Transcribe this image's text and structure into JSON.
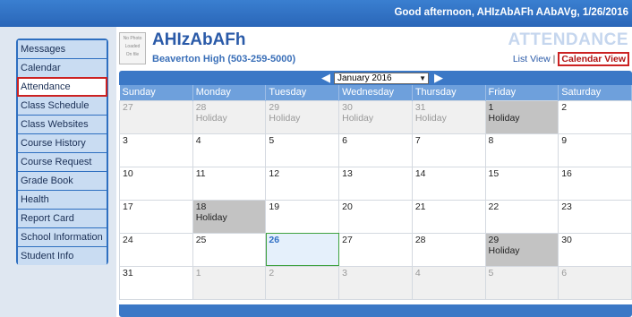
{
  "header": {
    "greeting": "Good afternoon, AHIzAbAFh AAbAVg, 1/26/2016"
  },
  "sidebar": {
    "items": [
      {
        "label": "Messages"
      },
      {
        "label": "Calendar"
      },
      {
        "label": "Attendance",
        "active": true
      },
      {
        "label": "Class Schedule"
      },
      {
        "label": "Class Websites"
      },
      {
        "label": "Course History"
      },
      {
        "label": "Course Request"
      },
      {
        "label": "Grade Book"
      },
      {
        "label": "Health"
      },
      {
        "label": "Report Card"
      },
      {
        "label": "School Information"
      },
      {
        "label": "Student Info"
      }
    ]
  },
  "student": {
    "name": "AHIzAbAFh",
    "school": "Beaverton High (503-259-5000)",
    "photo_line1": "No Photo",
    "photo_line2": "Loaded",
    "photo_line3": "On file"
  },
  "page": {
    "title": "ATTENDANCE",
    "list_view": "List View",
    "separator": "|",
    "calendar_view": "Calendar View"
  },
  "calendar": {
    "month_select": "January 2016",
    "weekdays": [
      "Sunday",
      "Monday",
      "Tuesday",
      "Wednesday",
      "Thursday",
      "Friday",
      "Saturday"
    ],
    "weeks": [
      [
        {
          "day": "27",
          "other": true
        },
        {
          "day": "28",
          "other": true,
          "note": "Holiday"
        },
        {
          "day": "29",
          "other": true,
          "note": "Holiday"
        },
        {
          "day": "30",
          "other": true,
          "note": "Holiday"
        },
        {
          "day": "31",
          "other": true,
          "note": "Holiday"
        },
        {
          "day": "1",
          "holiday": true,
          "note": "Holiday"
        },
        {
          "day": "2"
        }
      ],
      [
        {
          "day": "3"
        },
        {
          "day": "4"
        },
        {
          "day": "5"
        },
        {
          "day": "6"
        },
        {
          "day": "7"
        },
        {
          "day": "8"
        },
        {
          "day": "9"
        }
      ],
      [
        {
          "day": "10"
        },
        {
          "day": "11"
        },
        {
          "day": "12"
        },
        {
          "day": "13"
        },
        {
          "day": "14"
        },
        {
          "day": "15"
        },
        {
          "day": "16"
        }
      ],
      [
        {
          "day": "17"
        },
        {
          "day": "18",
          "holiday": true,
          "note": "Holiday"
        },
        {
          "day": "19"
        },
        {
          "day": "20"
        },
        {
          "day": "21"
        },
        {
          "day": "22"
        },
        {
          "day": "23"
        }
      ],
      [
        {
          "day": "24"
        },
        {
          "day": "25"
        },
        {
          "day": "26",
          "today": true
        },
        {
          "day": "27"
        },
        {
          "day": "28"
        },
        {
          "day": "29",
          "holiday": true,
          "note": "Holiday"
        },
        {
          "day": "30"
        }
      ],
      [
        {
          "day": "31"
        },
        {
          "day": "1",
          "other": true
        },
        {
          "day": "2",
          "other": true
        },
        {
          "day": "3",
          "other": true
        },
        {
          "day": "4",
          "other": true
        },
        {
          "day": "5",
          "other": true
        },
        {
          "day": "6",
          "other": true
        }
      ]
    ]
  },
  "colors": {
    "accent": "#2e6fc0",
    "highlight": "#cc2222",
    "holiday": "#c3c3c3",
    "today": "#e5f0fb"
  }
}
